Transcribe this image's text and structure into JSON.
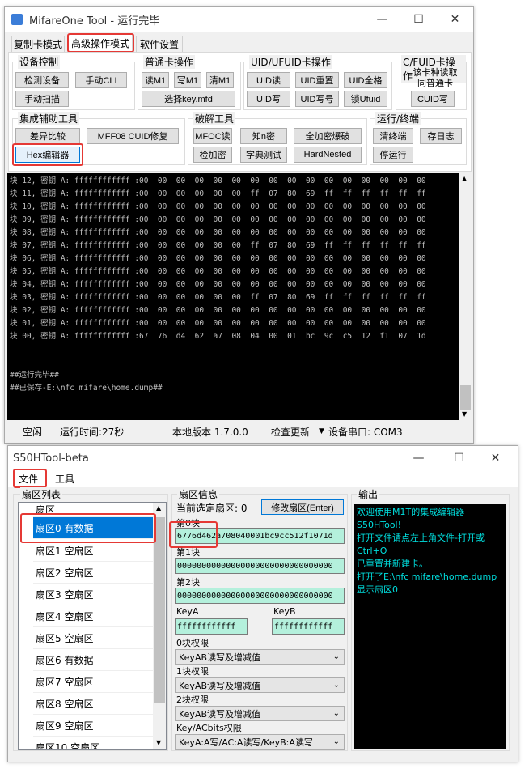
{
  "w1": {
    "title": "MifareOne Tool - 运行完毕",
    "tabs": [
      "复制卡模式",
      "高级操作模式",
      "软件设置"
    ],
    "groups": {
      "dev": "设备控制",
      "normal": "普通卡操作",
      "uid": "UID/UFUID卡操作",
      "cfuid": "C/FUID卡操作",
      "assist": "集成辅助工具",
      "crack": "破解工具",
      "run": "运行/终端"
    },
    "buttons": {
      "check_dev": "检测设备",
      "manual_cli": "手动CLI",
      "manual_scan": "手动扫描",
      "read_m1": "读M1",
      "write_m1": "写M1",
      "clear_m1": "清M1",
      "sel_key": "选择key.mfd",
      "uid_read": "UID读",
      "uid_reset": "UID重置",
      "uid_full": "UID全格",
      "uid_write": "UID写",
      "uid_num": "UID写号",
      "lock_ufuid": "锁Ufuid",
      "cfuid_note": "该卡种读取同普通卡",
      "cuid_write": "CUID写",
      "diff": "差异比较",
      "mff08": "MFF08 CUID修复",
      "hex_editor": "Hex编辑器",
      "mfoc": "MFOC读",
      "known": "知n密",
      "full_crack": "全加密爆破",
      "check_key": "检加密",
      "dict": "字典测试",
      "hardnested": "HardNested",
      "clear_term": "清终端",
      "save_log": "存日志",
      "stop": "停运行"
    },
    "console": [
      "块 12, 密钥 A: ffffffffffff :00  00  00  00  00  00  00  00  00  00  00  00  00  00  00  00",
      "块 11, 密钥 A: ffffffffffff :00  00  00  00  00  00  ff  07  80  69  ff  ff  ff  ff  ff  ff",
      "块 10, 密钥 A: ffffffffffff :00  00  00  00  00  00  00  00  00  00  00  00  00  00  00  00",
      "块 09, 密钥 A: ffffffffffff :00  00  00  00  00  00  00  00  00  00  00  00  00  00  00  00",
      "块 08, 密钥 A: ffffffffffff :00  00  00  00  00  00  00  00  00  00  00  00  00  00  00  00",
      "块 07, 密钥 A: ffffffffffff :00  00  00  00  00  00  ff  07  80  69  ff  ff  ff  ff  ff  ff",
      "块 06, 密钥 A: ffffffffffff :00  00  00  00  00  00  00  00  00  00  00  00  00  00  00  00",
      "块 05, 密钥 A: ffffffffffff :00  00  00  00  00  00  00  00  00  00  00  00  00  00  00  00",
      "块 04, 密钥 A: ffffffffffff :00  00  00  00  00  00  00  00  00  00  00  00  00  00  00  00",
      "块 03, 密钥 A: ffffffffffff :00  00  00  00  00  00  ff  07  80  69  ff  ff  ff  ff  ff  ff",
      "块 02, 密钥 A: ffffffffffff :00  00  00  00  00  00  00  00  00  00  00  00  00  00  00  00",
      "块 01, 密钥 A: ffffffffffff :00  00  00  00  00  00  00  00  00  00  00  00  00  00  00  00",
      "块 00, 密钥 A: ffffffffffff :67  76  d4  62  a7  08  04  00  01  bc  9c  c5  12  f1  07  1d"
    ],
    "console_tail": [
      "##运行完毕##",
      "##已保存-E:\\nfc mifare\\home.dump##"
    ],
    "status": {
      "state": "空闲",
      "time": "运行时间:27秒",
      "version": "本地版本 1.7.0.0",
      "update": "检查更新",
      "port": "设备串口: COM3"
    }
  },
  "w2": {
    "title": "S50HTool-beta",
    "menu": [
      "文件",
      "工具"
    ],
    "sector_group": "扇区列表",
    "sector_header": "扇区",
    "sectors": [
      "扇区0 有数据",
      "扇区1 空扇区",
      "扇区2 空扇区",
      "扇区3 空扇区",
      "扇区4 空扇区",
      "扇区5 空扇区",
      "扇区6 有数据",
      "扇区7 空扇区",
      "扇区8 空扇区",
      "扇区9 空扇区",
      "扇区10 空扇区"
    ],
    "info_group": "扇区信息",
    "current": "当前选定扇区: 0",
    "modify_btn": "修改扇区(Enter)",
    "blocks": [
      {
        "label": "第0块",
        "value": "6776d462a708040001bc9cc512f1071d"
      },
      {
        "label": "第1块",
        "value": "00000000000000000000000000000000"
      },
      {
        "label": "第2块",
        "value": "00000000000000000000000000000000"
      }
    ],
    "keya_label": "KeyA",
    "keya": "ffffffffffff",
    "keyb_label": "KeyB",
    "keyb": "ffffffffffff",
    "perms": [
      {
        "label": "0块权限",
        "value": "KeyAB读写及增减值"
      },
      {
        "label": "1块权限",
        "value": "KeyAB读写及增减值"
      },
      {
        "label": "2块权限",
        "value": "KeyAB读写及增减值"
      },
      {
        "label": "Key/ACbits权限",
        "value": "KeyA:A写/AC:A读写/KeyB:A读写"
      }
    ],
    "output_group": "输出",
    "output": [
      "欢迎使用M1T的集成编辑器",
      "S50HTool!",
      "打开文件请点左上角文件-打开或",
      "Ctrl+O",
      "已重置并新建卡。",
      "打开了E:\\nfc mifare\\home.dump",
      "显示扇区0"
    ]
  },
  "colors": {
    "highlight": "#e53935",
    "console_bg": "#000000",
    "output_text": "#00e0e0",
    "field_bg": "#b4f0dc",
    "selected": "#0078d7"
  }
}
